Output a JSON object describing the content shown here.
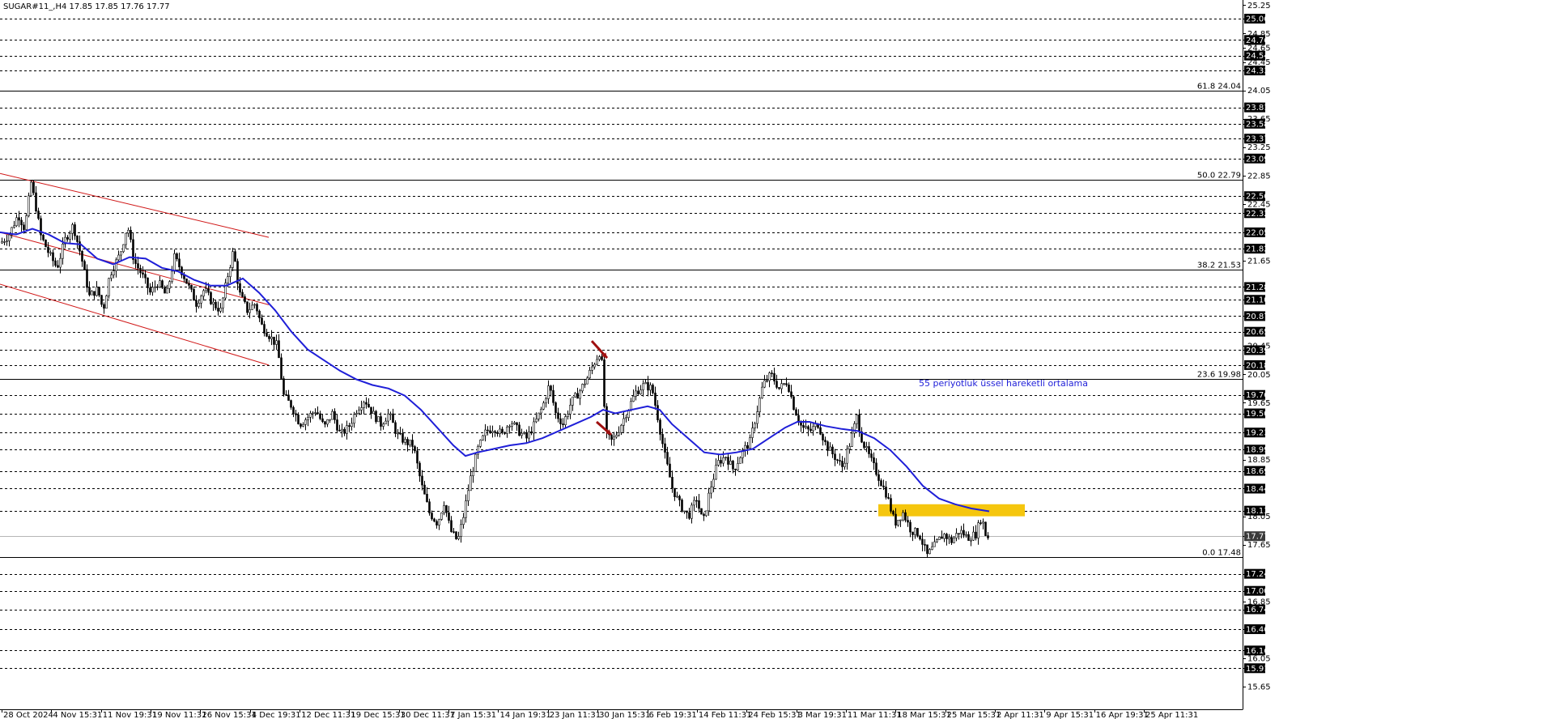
{
  "title": "SUGAR#11_,H4  17.85 17.85 17.76 17.77",
  "annotation": "55 periyotluk üssel hareketli ortalama",
  "colors": {
    "ema": "#1f1fd8",
    "channel": "#d01818",
    "zone": "#f5c60e",
    "arrow": "#a01010",
    "annotation": "#1f1fd8",
    "price_tag_bg": "#000000",
    "price_tag_fg": "#ffffff"
  },
  "chart_data": {
    "type": "candlestick",
    "ylim": [
      15.4,
      25.3
    ],
    "price_levels": [
      25.06,
      24.76,
      24.54,
      24.33,
      23.81,
      23.58,
      23.37,
      23.09,
      22.56,
      22.32,
      22.05,
      21.82,
      21.28,
      21.1,
      20.87,
      20.65,
      20.39,
      20.18,
      19.76,
      19.5,
      19.23,
      18.99,
      18.69,
      18.44,
      18.13,
      17.77,
      17.24,
      17.0,
      16.74,
      16.46,
      16.16,
      15.91
    ],
    "y_tick_labels": [
      "25.25",
      "25.06",
      "24.85",
      "24.76",
      "24.65",
      "24.54",
      "24.45",
      "24.33",
      "24.05",
      "23.81",
      "23.65",
      "23.58",
      "23.37",
      "23.25",
      "23.09",
      "22.85",
      "22.56",
      "22.45",
      "22.32",
      "22.05",
      "21.82",
      "21.65",
      "21.28",
      "21.10",
      "20.87",
      "20.65",
      "20.45",
      "20.39",
      "20.18",
      "20.05",
      "19.76",
      "19.65",
      "19.50",
      "19.23",
      "18.99",
      "18.85",
      "18.69",
      "18.44",
      "18.13",
      "18.05",
      "17.77",
      "17.65",
      "17.24",
      "17.00",
      "16.85",
      "16.74",
      "16.46",
      "16.16",
      "16.05",
      "15.91",
      "15.65"
    ],
    "highlighted_ticks": [
      "25.06",
      "24.76",
      "24.54",
      "24.33",
      "23.81",
      "23.58",
      "23.37",
      "23.09",
      "22.56",
      "22.32",
      "22.05",
      "21.82",
      "21.28",
      "21.10",
      "20.87",
      "20.65",
      "20.39",
      "20.18",
      "19.76",
      "19.50",
      "19.23",
      "18.99",
      "18.69",
      "18.44",
      "18.13",
      "17.77",
      "17.24",
      "17.00",
      "16.74",
      "16.46",
      "16.16",
      "15.91"
    ],
    "fib_levels": [
      {
        "label": "61.8 24.04",
        "value": 24.04
      },
      {
        "label": "50.0 22.79",
        "value": 22.79
      },
      {
        "label": "38.2 21.53",
        "value": 21.53
      },
      {
        "label": "23.6 19.98",
        "value": 19.98
      },
      {
        "label": "0.0 17.48",
        "value": 17.48
      }
    ],
    "current_price": 17.77,
    "x_labels": [
      "28 Oct 2024",
      "4 Nov 15:31",
      "11 Nov 19:31",
      "19 Nov 11:31",
      "26 Nov 15:31",
      "4 Dec 19:31",
      "12 Dec 11:31",
      "19 Dec 15:31",
      "30 Dec 11:31",
      "7 Jan 15:31",
      "14 Jan 19:31",
      "23 Jan 11:31",
      "30 Jan 15:31",
      "6 Feb 19:31",
      "14 Feb 11:31",
      "24 Feb 15:31",
      "3 Mar 19:31",
      "11 Mar 11:31",
      "18 Mar 15:31",
      "25 Mar 15:31",
      "2 Apr 11:31",
      "9 Apr 15:31",
      "16 Apr 19:31",
      "25 Apr 11:31"
    ],
    "price_path": [
      [
        0,
        21.9
      ],
      [
        10,
        22.0
      ],
      [
        22,
        22.3
      ],
      [
        30,
        22.1
      ],
      [
        38,
        22.75
      ],
      [
        44,
        22.4
      ],
      [
        50,
        22.0
      ],
      [
        60,
        21.75
      ],
      [
        70,
        21.55
      ],
      [
        80,
        21.95
      ],
      [
        90,
        22.15
      ],
      [
        100,
        21.7
      ],
      [
        110,
        21.15
      ],
      [
        120,
        21.25
      ],
      [
        127,
        20.95
      ],
      [
        135,
        21.45
      ],
      [
        148,
        21.75
      ],
      [
        157,
        22.15
      ],
      [
        165,
        21.65
      ],
      [
        175,
        21.45
      ],
      [
        185,
        21.2
      ],
      [
        195,
        21.35
      ],
      [
        205,
        21.15
      ],
      [
        215,
        21.7
      ],
      [
        222,
        21.55
      ],
      [
        232,
        21.3
      ],
      [
        242,
        21.05
      ],
      [
        252,
        21.25
      ],
      [
        262,
        21.05
      ],
      [
        272,
        20.95
      ],
      [
        282,
        21.5
      ],
      [
        288,
        21.8
      ],
      [
        295,
        21.2
      ],
      [
        305,
        20.95
      ],
      [
        315,
        21.05
      ],
      [
        322,
        20.75
      ],
      [
        332,
        20.6
      ],
      [
        342,
        20.45
      ],
      [
        350,
        19.75
      ],
      [
        360,
        19.6
      ],
      [
        370,
        19.35
      ],
      [
        380,
        19.45
      ],
      [
        390,
        19.55
      ],
      [
        400,
        19.3
      ],
      [
        410,
        19.5
      ],
      [
        420,
        19.2
      ],
      [
        430,
        19.3
      ],
      [
        440,
        19.55
      ],
      [
        450,
        19.7
      ],
      [
        460,
        19.5
      ],
      [
        470,
        19.35
      ],
      [
        480,
        19.5
      ],
      [
        490,
        19.2
      ],
      [
        500,
        19.1
      ],
      [
        510,
        19.05
      ],
      [
        520,
        18.5
      ],
      [
        530,
        18.1
      ],
      [
        540,
        17.95
      ],
      [
        548,
        18.25
      ],
      [
        556,
        17.85
      ],
      [
        565,
        17.7
      ],
      [
        572,
        18.05
      ],
      [
        580,
        18.55
      ],
      [
        590,
        19.0
      ],
      [
        600,
        19.25
      ],
      [
        610,
        19.3
      ],
      [
        620,
        19.2
      ],
      [
        630,
        19.4
      ],
      [
        640,
        19.25
      ],
      [
        650,
        19.15
      ],
      [
        660,
        19.35
      ],
      [
        670,
        19.6
      ],
      [
        678,
        19.9
      ],
      [
        686,
        19.5
      ],
      [
        695,
        19.35
      ],
      [
        705,
        19.65
      ],
      [
        715,
        19.8
      ],
      [
        725,
        20.0
      ],
      [
        733,
        20.2
      ],
      [
        742,
        20.4
      ],
      [
        748,
        19.2
      ],
      [
        756,
        19.1
      ],
      [
        765,
        19.3
      ],
      [
        775,
        19.55
      ],
      [
        785,
        19.8
      ],
      [
        795,
        19.9
      ],
      [
        805,
        19.85
      ],
      [
        812,
        19.45
      ],
      [
        820,
        18.95
      ],
      [
        830,
        18.45
      ],
      [
        840,
        18.2
      ],
      [
        850,
        18.05
      ],
      [
        860,
        18.3
      ],
      [
        868,
        17.95
      ],
      [
        876,
        18.4
      ],
      [
        886,
        18.8
      ],
      [
        896,
        18.9
      ],
      [
        906,
        18.7
      ],
      [
        916,
        18.95
      ],
      [
        926,
        19.1
      ],
      [
        934,
        19.5
      ],
      [
        942,
        19.9
      ],
      [
        952,
        20.05
      ],
      [
        962,
        19.85
      ],
      [
        972,
        19.95
      ],
      [
        980,
        19.6
      ],
      [
        990,
        19.3
      ],
      [
        1000,
        19.25
      ],
      [
        1010,
        19.35
      ],
      [
        1020,
        19.05
      ],
      [
        1030,
        18.9
      ],
      [
        1040,
        18.75
      ],
      [
        1050,
        19.1
      ],
      [
        1058,
        19.45
      ],
      [
        1065,
        19.1
      ],
      [
        1075,
        18.85
      ],
      [
        1085,
        18.6
      ],
      [
        1095,
        18.35
      ],
      [
        1105,
        17.95
      ],
      [
        1115,
        18.1
      ],
      [
        1125,
        17.85
      ],
      [
        1135,
        17.8
      ],
      [
        1145,
        17.5
      ],
      [
        1155,
        17.65
      ],
      [
        1165,
        17.8
      ],
      [
        1175,
        17.7
      ],
      [
        1185,
        17.85
      ],
      [
        1195,
        17.75
      ],
      [
        1205,
        17.8
      ],
      [
        1212,
        18.05
      ],
      [
        1218,
        17.75
      ],
      [
        1222,
        17.77
      ]
    ],
    "ema_path": [
      [
        0,
        22.05
      ],
      [
        20,
        22.02
      ],
      [
        40,
        22.1
      ],
      [
        60,
        22.02
      ],
      [
        80,
        21.9
      ],
      [
        100,
        21.88
      ],
      [
        120,
        21.68
      ],
      [
        140,
        21.6
      ],
      [
        160,
        21.7
      ],
      [
        180,
        21.68
      ],
      [
        200,
        21.55
      ],
      [
        220,
        21.5
      ],
      [
        240,
        21.38
      ],
      [
        260,
        21.3
      ],
      [
        280,
        21.3
      ],
      [
        300,
        21.4
      ],
      [
        320,
        21.2
      ],
      [
        340,
        20.95
      ],
      [
        360,
        20.65
      ],
      [
        380,
        20.4
      ],
      [
        400,
        20.25
      ],
      [
        420,
        20.1
      ],
      [
        440,
        19.98
      ],
      [
        460,
        19.9
      ],
      [
        480,
        19.85
      ],
      [
        500,
        19.75
      ],
      [
        520,
        19.55
      ],
      [
        540,
        19.3
      ],
      [
        560,
        19.05
      ],
      [
        575,
        18.9
      ],
      [
        590,
        18.95
      ],
      [
        610,
        19.0
      ],
      [
        630,
        19.05
      ],
      [
        650,
        19.08
      ],
      [
        670,
        19.15
      ],
      [
        690,
        19.25
      ],
      [
        710,
        19.35
      ],
      [
        730,
        19.45
      ],
      [
        745,
        19.55
      ],
      [
        760,
        19.5
      ],
      [
        780,
        19.55
      ],
      [
        800,
        19.6
      ],
      [
        815,
        19.55
      ],
      [
        830,
        19.35
      ],
      [
        850,
        19.15
      ],
      [
        870,
        18.95
      ],
      [
        890,
        18.92
      ],
      [
        910,
        18.95
      ],
      [
        930,
        19.0
      ],
      [
        950,
        19.15
      ],
      [
        970,
        19.3
      ],
      [
        985,
        19.38
      ],
      [
        1000,
        19.38
      ],
      [
        1020,
        19.32
      ],
      [
        1040,
        19.28
      ],
      [
        1060,
        19.25
      ],
      [
        1080,
        19.15
      ],
      [
        1100,
        18.98
      ],
      [
        1120,
        18.75
      ],
      [
        1140,
        18.48
      ],
      [
        1160,
        18.3
      ],
      [
        1180,
        18.22
      ],
      [
        1200,
        18.16
      ],
      [
        1222,
        18.12
      ]
    ],
    "channel_lines": [
      {
        "x1": 0,
        "y1": 22.88,
        "x2": 332,
        "y2": 21.98
      },
      {
        "x1": 0,
        "y1": 22.05,
        "x2": 332,
        "y2": 21.03
      },
      {
        "x1": 0,
        "y1": 21.32,
        "x2": 332,
        "y2": 20.18
      }
    ],
    "resistance_zone": {
      "x1": 1085,
      "x2": 1266,
      "y_top": 18.22,
      "y_bottom": 18.05
    }
  }
}
